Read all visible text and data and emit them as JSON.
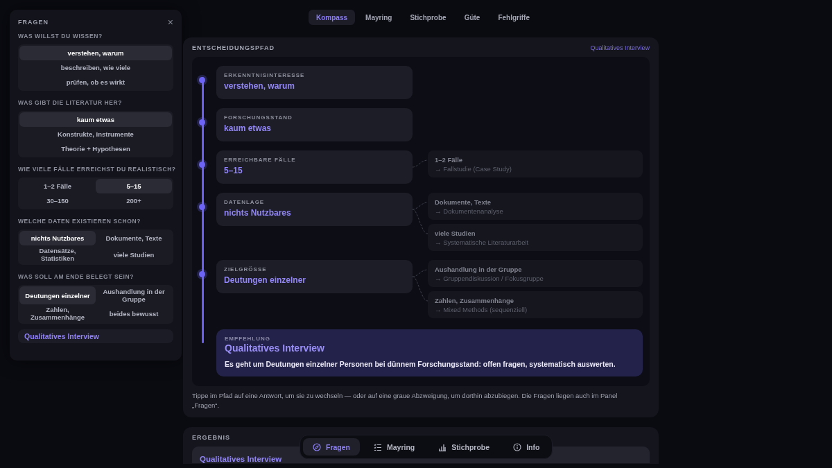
{
  "tabs": [
    {
      "label": "Kompass",
      "selected": true
    },
    {
      "label": "Mayring",
      "selected": false
    },
    {
      "label": "Stichprobe",
      "selected": false
    },
    {
      "label": "Güte",
      "selected": false
    },
    {
      "label": "Fehlgriffe",
      "selected": false
    }
  ],
  "panel": {
    "title": "FRAGEN",
    "close": "×",
    "questions": [
      {
        "heading": "WAS WILLST DU WISSEN?",
        "kind": "list",
        "options": [
          {
            "label": "verstehen, warum",
            "selected": true
          },
          {
            "label": "beschreiben, wie viele",
            "selected": false
          },
          {
            "label": "prüfen, ob es wirkt",
            "selected": false
          }
        ]
      },
      {
        "heading": "WAS GIBT DIE LITERATUR HER?",
        "kind": "list",
        "options": [
          {
            "label": "kaum etwas",
            "selected": true
          },
          {
            "label": "Konstrukte, Instrumente",
            "selected": false
          },
          {
            "label": "Theorie + Hypothesen",
            "selected": false
          }
        ]
      },
      {
        "heading": "WIE VIELE FÄLLE ERREICHST DU REALISTISCH?",
        "kind": "grid",
        "options": [
          {
            "label": "1–2 Fälle",
            "selected": false
          },
          {
            "label": "5–15",
            "selected": true
          },
          {
            "label": "30–150",
            "selected": false
          },
          {
            "label": "200+",
            "selected": false
          }
        ]
      },
      {
        "heading": "WELCHE DATEN EXISTIEREN SCHON?",
        "kind": "grid",
        "options": [
          {
            "label": "nichts Nutzbares",
            "selected": true
          },
          {
            "label": "Dokumente, Texte",
            "selected": false
          },
          {
            "label": "Datensätze, Statistiken",
            "selected": false
          },
          {
            "label": "viele Studien",
            "selected": false
          }
        ]
      },
      {
        "heading": "WAS SOLL AM ENDE BELEGT SEIN?",
        "kind": "grid",
        "options": [
          {
            "label": "Deutungen einzelner",
            "selected": true
          },
          {
            "label": "Aushandlung in der Gruppe",
            "selected": false
          },
          {
            "label": "Zahlen, Zusammenhänge",
            "selected": false
          },
          {
            "label": "beides bewusst",
            "selected": false
          }
        ]
      }
    ],
    "result": "Qualitatives Interview"
  },
  "path": {
    "title": "ENTSCHEIDUNGSPFAD",
    "result": "Qualitatives Interview",
    "steps": [
      {
        "label": "ERKENNTNISINTERESSE",
        "answer": "verstehen, warum"
      },
      {
        "label": "FORSCHUNGSSTAND",
        "answer": "kaum etwas"
      },
      {
        "label": "ERREICHBARE FÄLLE",
        "answer": "5–15",
        "branches": [
          {
            "answer": "1–2 Fälle",
            "method": "→ Fallstudie (Case Study)"
          }
        ]
      },
      {
        "label": "DATENLAGE",
        "answer": "nichts Nutzbares",
        "branches": [
          {
            "answer": "Dokumente, Texte",
            "method": "→ Dokumentenanalyse"
          },
          {
            "answer": "viele Studien",
            "method": "→ Systematische Literaturarbeit"
          }
        ]
      },
      {
        "label": "ZIELGRÖSSE",
        "answer": "Deutungen einzelner",
        "branches": [
          {
            "answer": "Aushandlung in der Gruppe",
            "method": "→ Gruppendiskussion / Fokusgruppe"
          },
          {
            "answer": "Zahlen, Zusammenhänge",
            "method": "→ Mixed Methods (sequenziell)"
          }
        ]
      }
    ],
    "recommendation": {
      "label": "EMPFEHLUNG",
      "title": "Qualitatives Interview",
      "text": "Es geht um Deutungen einzelner Personen bei dünnem Forschungsstand: offen fragen, systematisch auswerten."
    },
    "hint": "Tippe im Pfad auf eine Antwort, um sie zu wechseln — oder auf eine graue Abzweigung, um dorthin abzubiegen. Die Fragen liegen auch im Panel „Fragen“."
  },
  "result_section": {
    "title": "ERGEBNIS",
    "method": "Qualitatives Interview"
  },
  "bottom_nav": [
    {
      "label": "Fragen",
      "selected": true
    },
    {
      "label": "Mayring",
      "selected": false
    },
    {
      "label": "Stichprobe",
      "selected": false
    },
    {
      "label": "Info",
      "selected": false
    }
  ]
}
